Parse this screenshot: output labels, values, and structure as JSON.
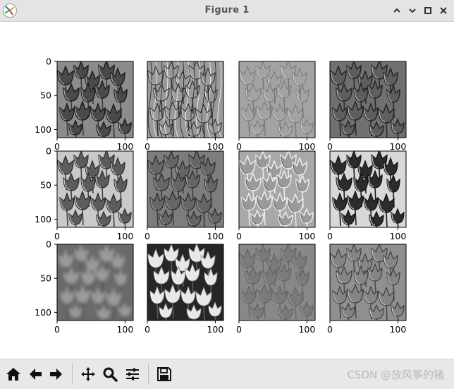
{
  "window": {
    "title": "Figure 1",
    "controls": [
      "minimize-up",
      "minimize",
      "maximize",
      "close"
    ]
  },
  "figure": {
    "rows": 3,
    "cols": 4,
    "panels": [
      {
        "style": "emboss-dark",
        "y_ticks": [
          "0",
          "50",
          "100"
        ],
        "x_ticks": [
          "0",
          "100"
        ]
      },
      {
        "style": "vertical-edges",
        "y_ticks": [],
        "x_ticks": [
          "0",
          "100"
        ]
      },
      {
        "style": "faint-edges",
        "y_ticks": [],
        "x_ticks": [
          "0",
          "100"
        ]
      },
      {
        "style": "emboss-shadow",
        "y_ticks": [],
        "x_ticks": [
          "0",
          "100"
        ]
      },
      {
        "style": "emboss-light",
        "y_ticks": [
          "0",
          "50",
          "100"
        ],
        "x_ticks": [
          "0",
          "100"
        ]
      },
      {
        "style": "emboss-mid",
        "y_ticks": [],
        "x_ticks": [
          "0",
          "100"
        ]
      },
      {
        "style": "outline-light",
        "y_ticks": [],
        "x_ticks": [
          "0",
          "100"
        ]
      },
      {
        "style": "contrast-dark",
        "y_ticks": [],
        "x_ticks": [
          "0",
          "100"
        ]
      },
      {
        "style": "blurred",
        "y_ticks": [
          "0",
          "50",
          "100"
        ],
        "x_ticks": [
          "0",
          "100"
        ]
      },
      {
        "style": "photo",
        "y_ticks": [],
        "x_ticks": [
          "0",
          "100"
        ]
      },
      {
        "style": "flat-gray",
        "y_ticks": [],
        "x_ticks": [
          "0",
          "100"
        ]
      },
      {
        "style": "relief",
        "y_ticks": [],
        "x_ticks": [
          "0",
          "100"
        ]
      }
    ]
  },
  "toolbar": {
    "tools": [
      "home-icon",
      "back-icon",
      "forward-icon",
      "pan-icon",
      "zoom-icon",
      "configure-subplots-icon",
      "save-icon"
    ],
    "watermark": "CSDN @放风筝的猪"
  }
}
